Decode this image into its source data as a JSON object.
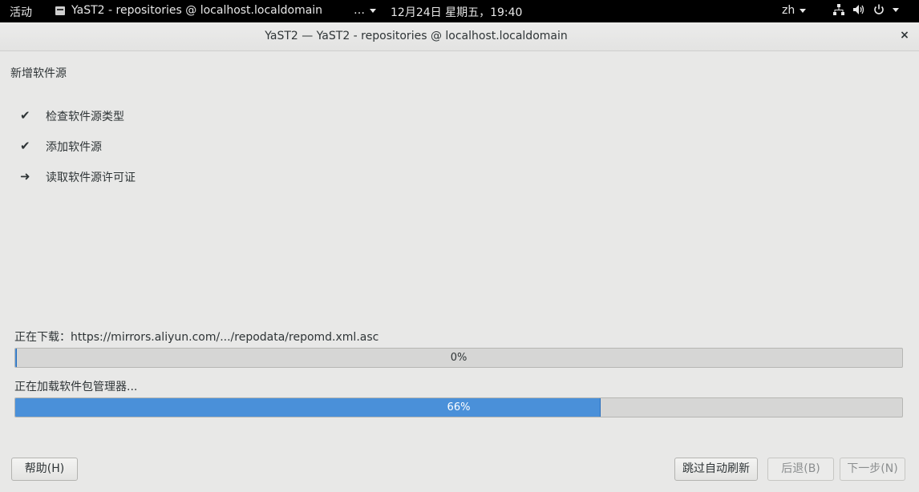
{
  "topbar": {
    "activities": "活动",
    "app_title": "YaST2 - repositories @ localhost.localdomain",
    "more": "…",
    "clock": "12月24日 星期五，19:40",
    "language": "zh"
  },
  "window": {
    "title": "YaST2 — YaST2 - repositories @ localhost.localdomain",
    "close": "×"
  },
  "dialog": {
    "heading": "新增软件源",
    "steps": [
      {
        "mark": "✔",
        "label": "检查软件源类型",
        "status": "done"
      },
      {
        "mark": "✔",
        "label": "添加软件源",
        "status": "done"
      },
      {
        "mark": "➜",
        "label": "读取软件源许可证",
        "status": "current"
      }
    ],
    "download_label": "正在下载：https://mirrors.aliyun.com/.../repodata/repomd.xml.asc",
    "download_progress": {
      "value": 0,
      "text": "0%"
    },
    "pkgmgr_label": "正在加载软件包管理器...",
    "pkgmgr_progress": {
      "value": 66,
      "text": "66%"
    }
  },
  "buttons": {
    "help": "帮助(H)",
    "skip_refresh": "跳过自动刷新",
    "back": "后退(B)",
    "next": "下一步(N)"
  },
  "colors": {
    "accent": "#4a90d9",
    "topbar": "#000000",
    "window_bg": "#e8e8e7"
  }
}
